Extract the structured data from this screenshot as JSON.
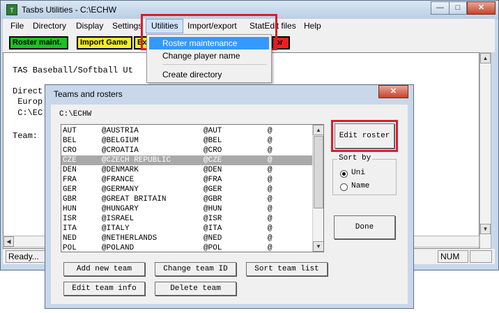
{
  "main_window": {
    "title": "Tasbs Utilities - C:\\ECHW",
    "app_icon_glyph": "T",
    "caption": {
      "minimize": "—",
      "maximize": "□",
      "close": "✕"
    }
  },
  "menubar": [
    {
      "label": "File"
    },
    {
      "label": "Directory"
    },
    {
      "label": "Display"
    },
    {
      "label": "Settings"
    },
    {
      "label": "Utilities"
    },
    {
      "label": "Import/export"
    },
    {
      "label": "StatEdit files"
    },
    {
      "label": "Help"
    }
  ],
  "toolbar": {
    "roster_maint": "Roster maint.",
    "import_game": "Import Game",
    "ex": "Ex",
    "right_fragment": "or"
  },
  "dropdown": {
    "items": [
      "Roster maintenance",
      "Change player name",
      "Create directory"
    ]
  },
  "client_text": {
    "line1": "TAS Baseball/Softball Ut",
    "line2": "Direct",
    "line3": " Europ",
    "line4": " C:\\EC",
    "line5": "Team:"
  },
  "statusbar": {
    "ready": "Ready...",
    "num": "NUM"
  },
  "dialog": {
    "title": "Teams and rosters",
    "path": "C:\\ECHW",
    "teams": [
      {
        "code": "AUT",
        "name": "@AUSTRIA",
        "tag": "@AUT",
        "extra": "@"
      },
      {
        "code": "BEL",
        "name": "@BELGIUM",
        "tag": "@BEL",
        "extra": "@"
      },
      {
        "code": "CRO",
        "name": "@CROATIA",
        "tag": "@CRO",
        "extra": "@"
      },
      {
        "code": "CZE",
        "name": "@CZECH REPUBLIC",
        "tag": "@CZE",
        "extra": "@"
      },
      {
        "code": "DEN",
        "name": "@DENMARK",
        "tag": "@DEN",
        "extra": "@"
      },
      {
        "code": "FRA",
        "name": "@FRANCE",
        "tag": "@FRA",
        "extra": "@"
      },
      {
        "code": "GER",
        "name": "@GERMANY",
        "tag": "@GER",
        "extra": "@"
      },
      {
        "code": "GBR",
        "name": "@GREAT BRITAIN",
        "tag": "@GBR",
        "extra": "@"
      },
      {
        "code": "HUN",
        "name": "@HUNGARY",
        "tag": "@HUN",
        "extra": "@"
      },
      {
        "code": "ISR",
        "name": "@ISRAEL",
        "tag": "@ISR",
        "extra": "@"
      },
      {
        "code": "ITA",
        "name": "@ITALY",
        "tag": "@ITA",
        "extra": "@"
      },
      {
        "code": "NED",
        "name": "@NETHERLANDS",
        "tag": "@NED",
        "extra": "@"
      },
      {
        "code": "POL",
        "name": "@POLAND",
        "tag": "@POL",
        "extra": "@"
      }
    ],
    "selected_team": "CZE",
    "buttons": {
      "edit_roster": "Edit roster",
      "done": "Done",
      "add_new_team": "Add new team",
      "change_team_id": "Change team ID",
      "sort_team_list": "Sort team list",
      "edit_team_info": "Edit team info",
      "delete_team": "Delete team"
    },
    "sort": {
      "label": "Sort by",
      "options": [
        "Uni",
        "Name"
      ],
      "selected": "Uni"
    }
  },
  "colors": {
    "highlight_box": "#d81e2c",
    "menu_selected": "#3399ff",
    "roster_button": "#19c41f",
    "import_button": "#f5ec21",
    "toolbar_red_button": "#ea2020"
  }
}
